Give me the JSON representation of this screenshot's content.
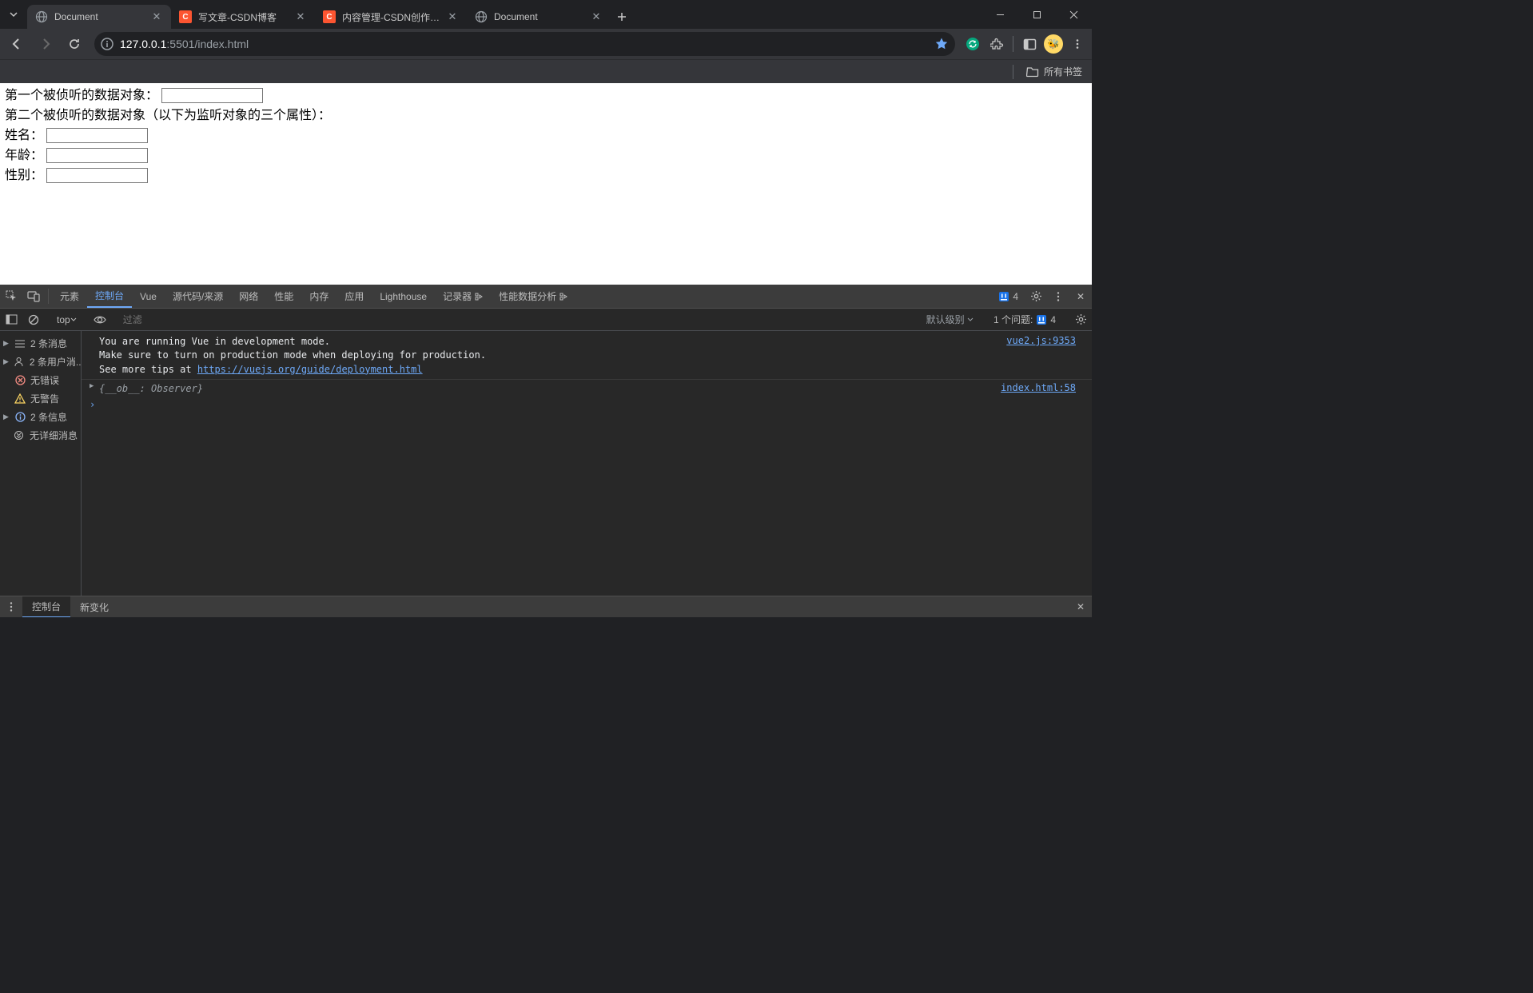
{
  "tabs": [
    {
      "title": "Document",
      "icon": "globe"
    },
    {
      "title": "写文章-CSDN博客",
      "icon": "csdn"
    },
    {
      "title": "内容管理-CSDN创作中心",
      "icon": "csdn"
    },
    {
      "title": "Document",
      "icon": "globe"
    }
  ],
  "url": {
    "host": "127.0.0.1",
    "port": ":5501",
    "path": "/index.html"
  },
  "bookmark_bar": {
    "all_bookmarks": "所有书签"
  },
  "page": {
    "label1": "第一个被侦听的数据对象：",
    "label2": "第二个被侦听的数据对象（以下为监听对象的三个属性）：",
    "field_name": "姓名：",
    "field_age": "年龄：",
    "field_gender": "性别："
  },
  "devtools": {
    "tabs": {
      "elements": "元素",
      "console": "控制台",
      "vue": "Vue",
      "sources": "源代码/来源",
      "network": "网络",
      "performance": "性能",
      "memory": "内存",
      "application": "应用",
      "lighthouse": "Lighthouse",
      "recorder": "记录器",
      "perf_insights": "性能数据分析"
    },
    "issues_count": "4",
    "console_toolbar": {
      "top": "top",
      "filter_placeholder": "过滤",
      "level": "默认级别",
      "issues_label": "1 个问题:",
      "issues_num": "4"
    },
    "sidebar": {
      "messages": "2 条消息",
      "user_messages": "2 条用户消...",
      "no_errors": "无错误",
      "no_warnings": "无警告",
      "info": "2 条信息",
      "no_verbose": "无详细消息"
    },
    "console": {
      "line1": "You are running Vue in development mode.",
      "line2": "Make sure to turn on production mode when deploying for production.",
      "line3_prefix": "See more tips at ",
      "line3_link": "https://vuejs.org/guide/deployment.html",
      "src1": "vue2.js:9353",
      "obj": "{__ob__: Observer}",
      "src2": "index.html:58"
    },
    "drawer": {
      "console": "控制台",
      "whatsnew": "新变化"
    }
  }
}
